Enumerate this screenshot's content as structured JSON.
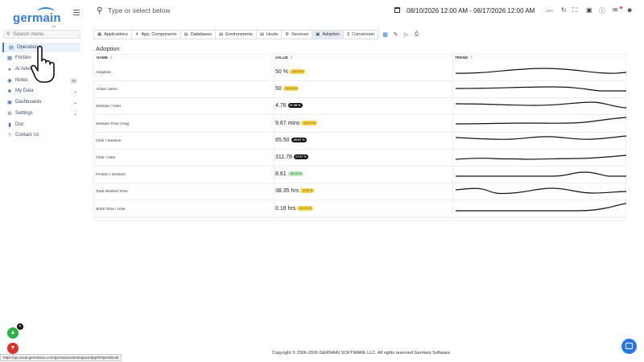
{
  "app": {
    "logo": "germain",
    "logo_sub": "UX"
  },
  "sidebar": {
    "search_placeholder": "Search menu",
    "items": [
      {
        "label": "Operational",
        "icon": "chart-icon",
        "active": true
      },
      {
        "label": "Friction",
        "icon": "friction-icon"
      },
      {
        "label": "AI Advisor",
        "icon": "ai-icon"
      },
      {
        "label": "Notes",
        "icon": "note-icon",
        "count": "40"
      },
      {
        "label": "My Data",
        "icon": "folder-icon",
        "chevron": true
      },
      {
        "label": "Dashboards",
        "icon": "dashboard-icon",
        "chevron": true
      },
      {
        "label": "Settings",
        "icon": "gear-icon",
        "chevron": true
      },
      {
        "label": "Doc",
        "icon": "book-icon"
      },
      {
        "label": "Contact Us",
        "icon": "help-icon"
      }
    ]
  },
  "topbar": {
    "search_placeholder": "Type or select below",
    "date_range": "08/10/2026 12:00 AM - 08/17/2026 12:00 AM",
    "timezone": "UTC"
  },
  "tabs": [
    {
      "label": "Applications",
      "icon": "grid-icon"
    },
    {
      "label": "App. Components",
      "icon": "puzzle-icon"
    },
    {
      "label": "Databases",
      "icon": "database-icon"
    },
    {
      "label": "Environments",
      "icon": "server-icon"
    },
    {
      "label": "Hosts",
      "icon": "host-icon"
    },
    {
      "label": "Services",
      "icon": "services-icon"
    },
    {
      "label": "Adoption",
      "icon": "adoption-icon",
      "active": true
    },
    {
      "label": "Conversion",
      "icon": "dollar-icon"
    }
  ],
  "panel": {
    "title": "Adoption",
    "columns": {
      "metric": "NAME",
      "value": "VALUE",
      "trend": "TREND"
    },
    "rows": [
      {
        "metric": "Adoption",
        "value": "50 %",
        "change": "-18.03 %",
        "style": "yellow"
      },
      {
        "metric": "Active Users",
        "value": "50",
        "change": "-18.03 %",
        "style": "yellow"
      },
      {
        "metric": "Session / User",
        "value": "4.76",
        "change": "47.39 %",
        "style": "black"
      },
      {
        "metric": "Session Time (Avg)",
        "value": "9.67 mins",
        "change": "-15.31 %",
        "style": "yellow"
      },
      {
        "metric": "Click / Session",
        "value": "65.50",
        "change": "-20.57 %",
        "style": "black"
      },
      {
        "metric": "Click / User",
        "value": "311.78",
        "change": "17.07 %",
        "style": "black"
      },
      {
        "metric": "Friction / Session",
        "value": "8.61",
        "change": "-30.29 %",
        "style": "green"
      },
      {
        "metric": "Total Worked Time",
        "value": "38.35 hrs",
        "change": "-5.39 %",
        "style": "yellow"
      },
      {
        "metric": "Work Time / User",
        "value": "0.16 hrs",
        "change": "-16.21 %",
        "style": "yellow"
      }
    ]
  },
  "footer": "Copyright © 2006-2026 GERMAIN SOFTWARE LLC. All rights reserved Germain Software.",
  "statusbar": "https://qa.cloud.germainux.com/germainux/workspace/app/#Operational",
  "colors": {
    "accent": "#3a7bd5",
    "yellow": "#f5d34a",
    "green": "#b9ecb9",
    "black": "#111111"
  }
}
